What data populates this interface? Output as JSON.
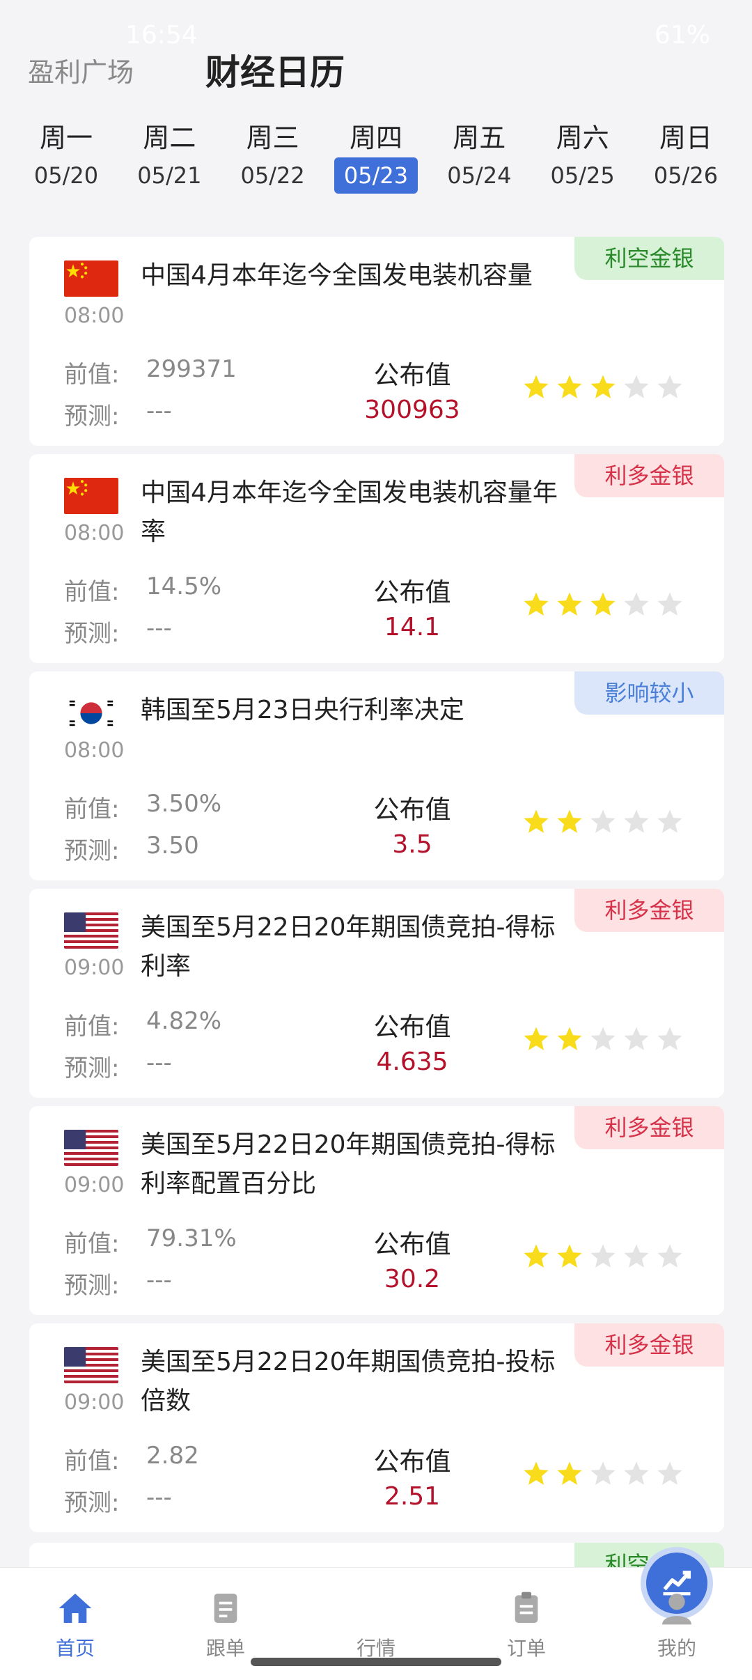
{
  "status_bar": {
    "time": "16:54",
    "battery": "61%"
  },
  "header": {
    "tab_plaza": "盈利广场",
    "tab_calendar": "财经日历"
  },
  "week": [
    {
      "name": "周一",
      "date": "05/20"
    },
    {
      "name": "周二",
      "date": "05/21"
    },
    {
      "name": "周三",
      "date": "05/22"
    },
    {
      "name": "周四",
      "date": "05/23"
    },
    {
      "name": "周五",
      "date": "05/24"
    },
    {
      "name": "周六",
      "date": "05/25"
    },
    {
      "name": "周日",
      "date": "05/26"
    }
  ],
  "active_day_index": 3,
  "labels": {
    "previous": "前值:",
    "forecast": "预测:",
    "published": "公布值"
  },
  "events": [
    {
      "flag": "china-flag",
      "time": "08:00",
      "title": "中国4月本年迄今全国发电装机容量",
      "badge": "利空金银",
      "badge_type": "bear",
      "previous": "299371",
      "forecast": "---",
      "published": "300963",
      "stars": 3
    },
    {
      "flag": "china-flag",
      "time": "08:00",
      "title": "中国4月本年迄今全国发电装机容量年率",
      "badge": "利多金银",
      "badge_type": "bull",
      "previous": "14.5%",
      "forecast": "---",
      "published": "14.1",
      "stars": 3
    },
    {
      "flag": "korea-flag",
      "time": "08:00",
      "title": "韩国至5月23日央行利率决定",
      "badge": "影响较小",
      "badge_type": "minor",
      "previous": "3.50%",
      "forecast": "3.50",
      "published": "3.5",
      "stars": 2
    },
    {
      "flag": "usa-flag",
      "time": "09:00",
      "title": "美国至5月22日20年期国债竞拍-得标利率",
      "badge": "利多金银",
      "badge_type": "bull",
      "previous": "4.82%",
      "forecast": "---",
      "published": "4.635",
      "stars": 2
    },
    {
      "flag": "usa-flag",
      "time": "09:00",
      "title": "美国至5月22日20年期国债竞拍-得标利率配置百分比",
      "badge": "利多金银",
      "badge_type": "bull",
      "previous": "79.31%",
      "forecast": "---",
      "published": "30.2",
      "stars": 2
    },
    {
      "flag": "usa-flag",
      "time": "09:00",
      "title": "美国至5月22日20年期国债竞拍-投标倍数",
      "badge": "利多金银",
      "badge_type": "bull",
      "previous": "2.82",
      "forecast": "---",
      "published": "2.51",
      "stars": 2
    }
  ],
  "partial_event": {
    "badge": "利空金银",
    "badge_type": "bear"
  },
  "colors": {
    "accent": "#3f6fd8",
    "published_value": "#b4122a",
    "star_on": "#f8dc1c",
    "star_off": "#e3e3e3"
  },
  "bottom_nav": [
    {
      "label": "首页",
      "icon": "home-icon"
    },
    {
      "label": "跟单",
      "icon": "document-icon"
    },
    {
      "label": "行情",
      "icon": "chart-icon"
    },
    {
      "label": "订单",
      "icon": "clipboard-icon"
    },
    {
      "label": "我的",
      "icon": "user-icon"
    }
  ],
  "active_nav_index": 0
}
